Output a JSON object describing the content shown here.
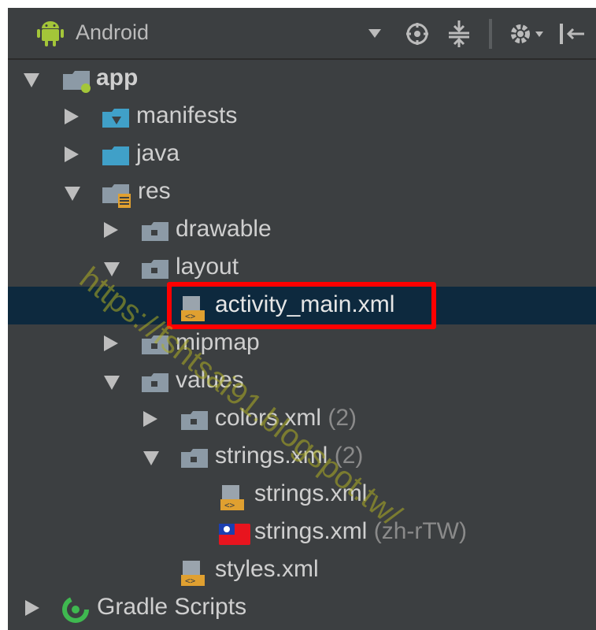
{
  "header": {
    "view_mode": "Android",
    "icons": [
      "android-icon",
      "dropdown-icon",
      "locate-icon",
      "collapse-all-icon",
      "settings-icon",
      "hide-panel-icon"
    ]
  },
  "tree": {
    "app": "app",
    "manifests": "manifests",
    "java": "java",
    "res": "res",
    "drawable": "drawable",
    "layout": "layout",
    "activity_main": "activity_main.xml",
    "mipmap": "mipmap",
    "values": "values",
    "colors": "colors.xml",
    "colors_count": "(2)",
    "strings_group": "strings.xml",
    "strings_count": "(2)",
    "strings": "strings.xml",
    "strings_tw": "strings.xml",
    "strings_tw_locale": "(zh-rTW)",
    "styles": "styles.xml",
    "gradle": "Gradle Scripts"
  },
  "watermark": "https://fshtsai91.blogspot.tw/",
  "colors": {
    "panel_bg": "#3c3f41",
    "selection_bg": "#0d293e",
    "highlight_border": "#ff0000",
    "text": "#cfcfcf",
    "muted_text": "#8a8a8a",
    "android_green": "#a4c639",
    "gradle_green": "#3fb950"
  }
}
